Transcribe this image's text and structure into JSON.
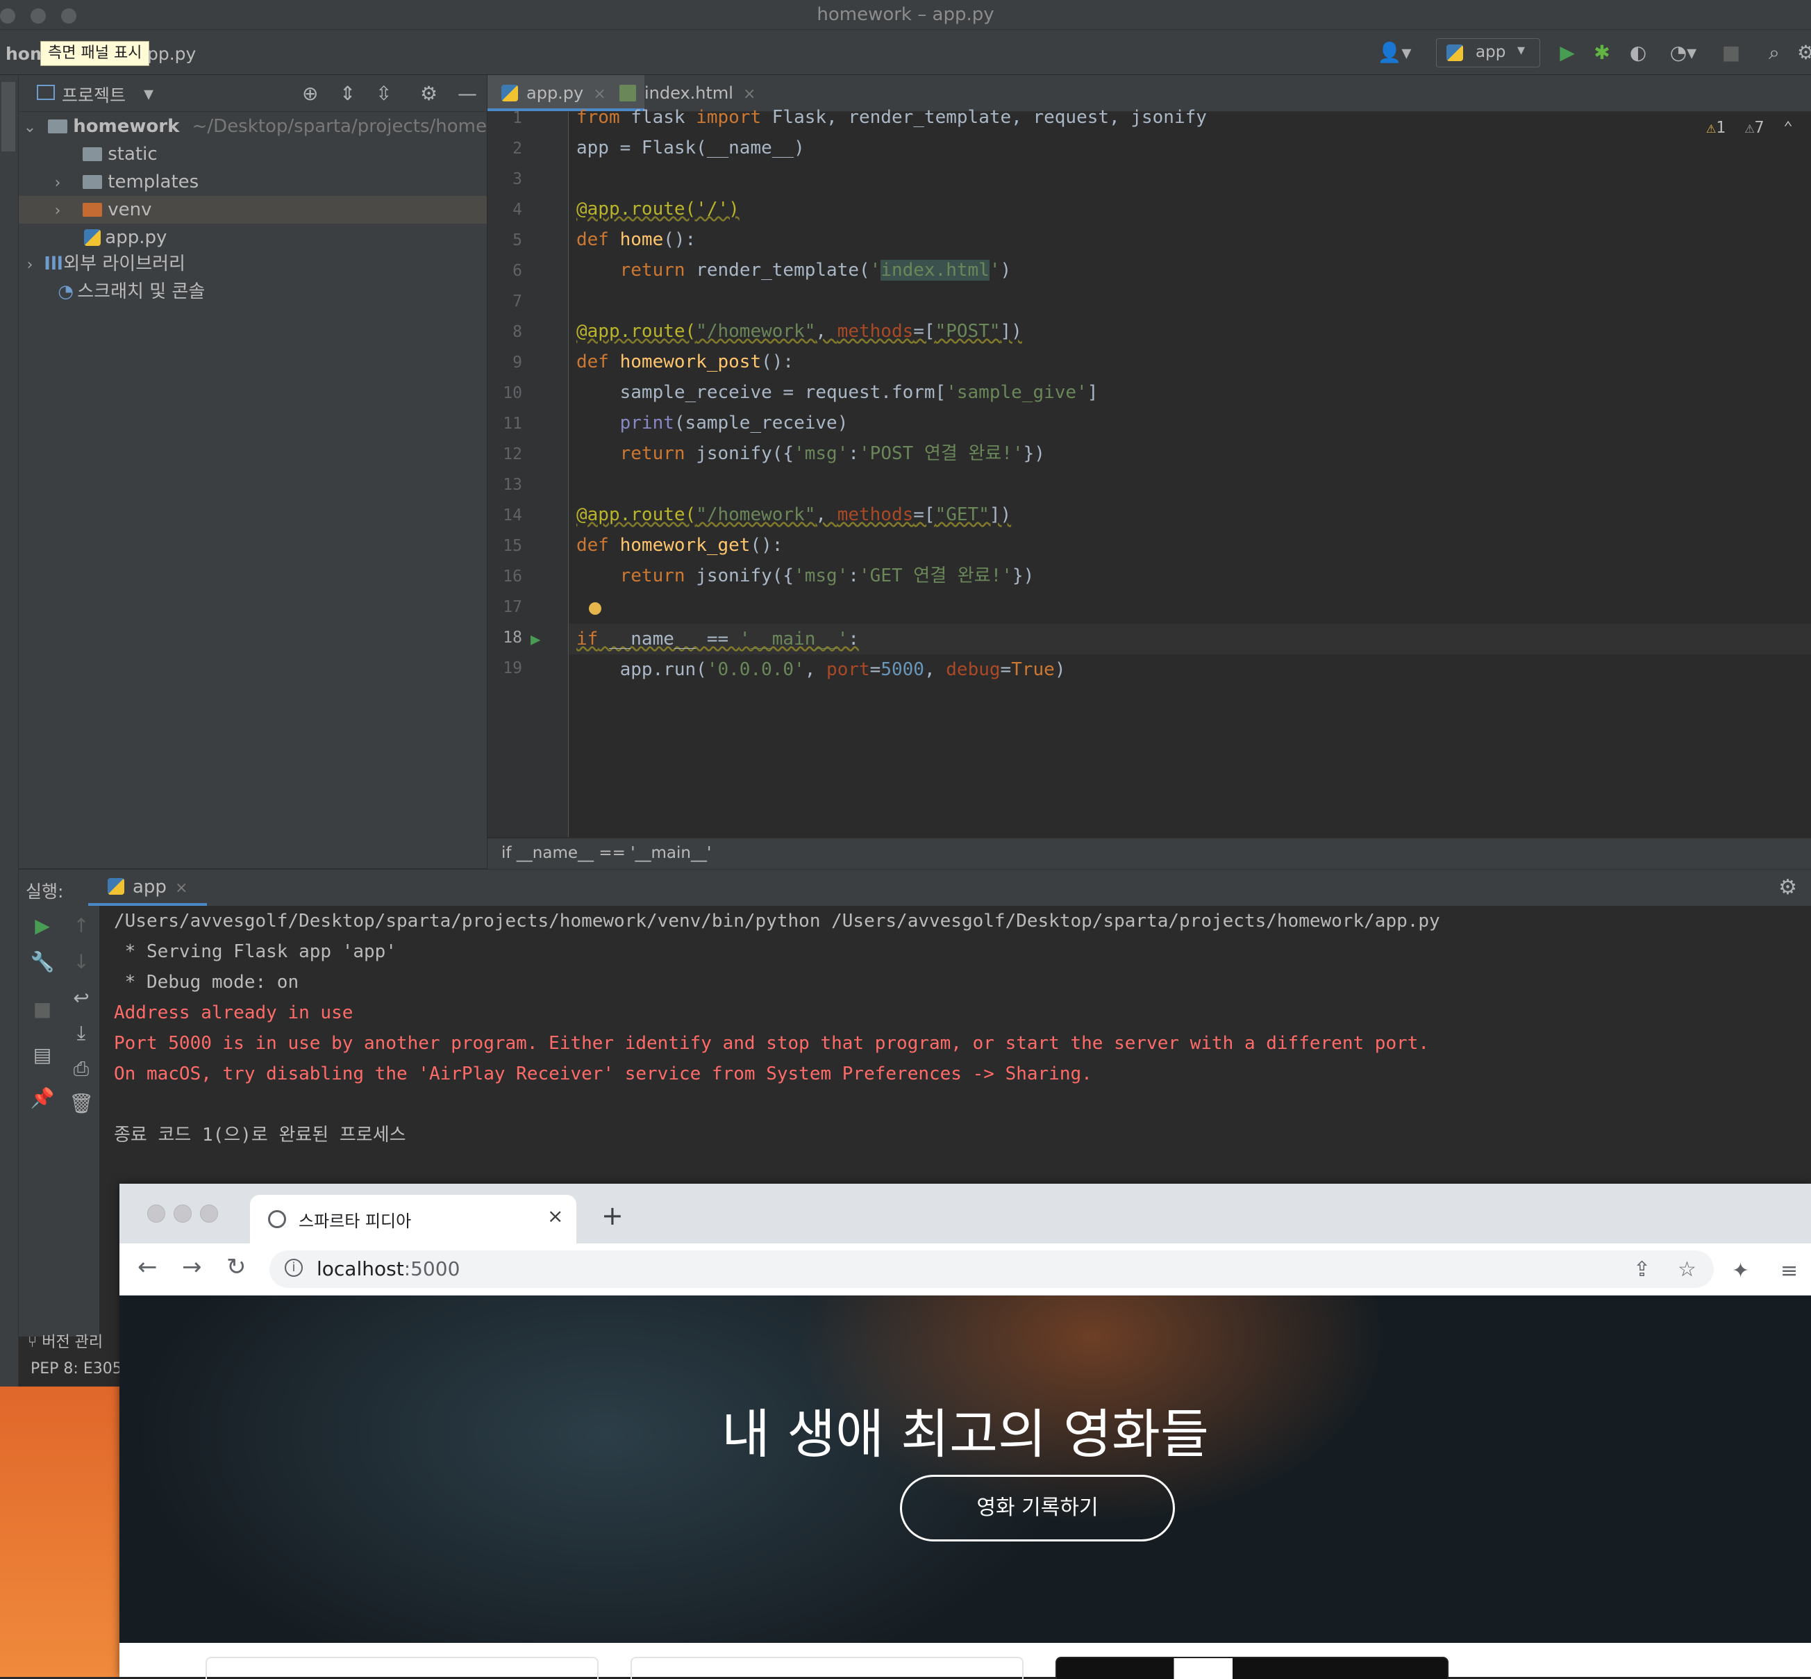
{
  "window": {
    "title": "homework – app.py"
  },
  "navbar": {
    "project_crumb": "hom",
    "tooltip": "측면 패널 표시",
    "file_crumb": "pp.py",
    "run_config": "app"
  },
  "project_panel": {
    "title": "프로젝트",
    "tree": {
      "root_name": "homework",
      "root_path": "~/Desktop/sparta/projects/homework",
      "static": "static",
      "templates": "templates",
      "venv": "venv",
      "app_py": "app.py",
      "external_libs": "외부 라이브러리",
      "scratches": "스크래치 및 콘솔"
    }
  },
  "editor": {
    "tabs": [
      {
        "label": "app.py"
      },
      {
        "label": "index.html"
      }
    ],
    "inspections": {
      "warn1": "1",
      "warn2": "7"
    },
    "line_numbers": [
      "1",
      "2",
      "3",
      "4",
      "5",
      "6",
      "7",
      "8",
      "9",
      "10",
      "11",
      "12",
      "13",
      "14",
      "15",
      "16",
      "17",
      "18",
      "19"
    ],
    "code": {
      "l1": {
        "a": "from",
        "b": " flask ",
        "c": "import",
        "d": " Flask, render_template, request, jsonify"
      },
      "l2": "app = Flask(__name__)",
      "l4": "@app.route('/')",
      "l5": {
        "kw": "def",
        "fn": " home",
        "rest": "():"
      },
      "l6": {
        "kw": "    return",
        "a": " render_template(",
        "q1": "'",
        "str": "index.html",
        "q2": "'",
        "b": ")"
      },
      "l8": {
        "dec": "@app.route(",
        "s1": "\"/homework\"",
        "c": ", ",
        "par": "methods",
        "eq": "=[",
        "s2": "\"POST\"",
        "end": "])"
      },
      "l9": {
        "kw": "def",
        "fn": " homework_post",
        "rest": "():"
      },
      "l10": {
        "a": "    sample_receive = request.form[",
        "str": "'sample_give'",
        "b": "]"
      },
      "l11": {
        "bi": "    print",
        "rest": "(sample_receive)"
      },
      "l12": {
        "kw": "    return",
        "a": " jsonify({",
        "s1": "'msg'",
        "c": ":",
        "s2": "'POST 연결 완료!'",
        "b": "})"
      },
      "l14": {
        "dec": "@app.route(",
        "s1": "\"/homework\"",
        "c": ", ",
        "par": "methods",
        "eq": "=[",
        "s2": "\"GET\"",
        "end": "])"
      },
      "l15": {
        "kw": "def",
        "fn": " homework_get",
        "rest": "():"
      },
      "l16": {
        "kw": "    return",
        "a": " jsonify({",
        "s1": "'msg'",
        "c": ":",
        "s2": "'GET 연결 완료!'",
        "b": "})"
      },
      "l18": {
        "kw": "if",
        "a": " __name__ == ",
        "str": "'__main__'",
        "b": ":"
      },
      "l19": {
        "a": "    app.run(",
        "s1": "'0.0.0.0'",
        "c1": ", ",
        "p1": "port",
        "e1": "=",
        "n": "5000",
        "c2": ", ",
        "p2": "debug",
        "e2": "=",
        "kw": "True",
        "b": ")"
      }
    },
    "breadcrumb": "if __name__ == '__main__'"
  },
  "run_panel": {
    "title": "실행:",
    "tab": "app",
    "console": [
      {
        "text": "/Users/avvesgolf/Desktop/sparta/projects/homework/venv/bin/python /Users/avvesgolf/Desktop/sparta/projects/homework/app.py",
        "err": false
      },
      {
        "text": " * Serving Flask app 'app'",
        "err": false
      },
      {
        "text": " * Debug mode: on",
        "err": false
      },
      {
        "text": "Address already in use",
        "err": true
      },
      {
        "text": "Port 5000 is in use by another program. Either identify and stop that program, or start the server with a different port.",
        "err": true
      },
      {
        "text": "On macOS, try disabling the 'AirPlay Receiver' service from System Preferences -> Sharing.",
        "err": true
      },
      {
        "text": "",
        "err": false
      },
      {
        "text": "종료 코드 1(으)로 완료된 프로세스",
        "err": false
      }
    ]
  },
  "status": {
    "vcs": "버전 관리",
    "pep": "PEP 8: E305"
  },
  "browser": {
    "tab_title": "스파르타 피디아",
    "url_host": "localhost",
    "url_port": ":5000",
    "hero_title": "내 생애 최고의 영화들",
    "hero_button": "영화 기록하기"
  }
}
